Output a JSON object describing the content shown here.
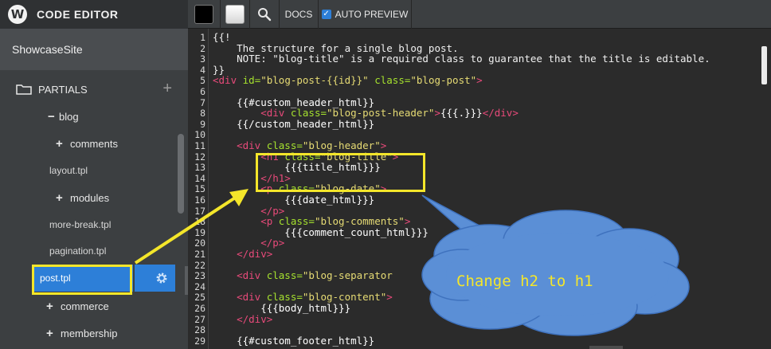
{
  "app": {
    "title": "CODE EDITOR",
    "logo_letter": "W"
  },
  "site": {
    "name": "ShowcaseSite"
  },
  "sidebar": {
    "section_label": "PARTIALS",
    "add_symbol": "+",
    "tree": [
      {
        "sign": "−",
        "label": "blog"
      },
      {
        "sign": "+",
        "label": "comments"
      },
      {
        "sign": "",
        "label": "layout.tpl"
      },
      {
        "sign": "+",
        "label": "modules"
      },
      {
        "sign": "",
        "label": "more-break.tpl"
      },
      {
        "sign": "",
        "label": "pagination.tpl"
      },
      {
        "sign": "",
        "label": "post.tpl"
      },
      {
        "sign": "+",
        "label": "commerce"
      },
      {
        "sign": "+",
        "label": "membership"
      }
    ]
  },
  "toolbar": {
    "swatch_dark_color": "#000000",
    "swatch_light_color": "#ffffff",
    "docs_label": "DOCS",
    "auto_preview_label": "AUTO PREVIEW",
    "auto_preview_checked": true,
    "check_mark": "✓"
  },
  "editor": {
    "lines": [
      {
        "n": "1",
        "segs": [
          [
            "cm",
            "{{!"
          ]
        ]
      },
      {
        "n": "2",
        "segs": [
          [
            "cm",
            "    The structure for a single blog post."
          ]
        ]
      },
      {
        "n": "3",
        "segs": [
          [
            "cm",
            "    NOTE: \"blog-title\" is a required class to guarantee that the title is editable."
          ]
        ]
      },
      {
        "n": "4",
        "segs": [
          [
            "cm",
            "}}"
          ]
        ]
      },
      {
        "n": "5",
        "segs": [
          [
            "t",
            "<div "
          ],
          [
            "a",
            "id="
          ],
          [
            "s",
            "\"blog-post-{{id}}\""
          ],
          [
            "a",
            " class="
          ],
          [
            "s",
            "\"blog-post\""
          ],
          [
            "t",
            ">"
          ]
        ]
      },
      {
        "n": "6",
        "segs": []
      },
      {
        "n": "7",
        "segs": [
          [
            "hb",
            "    {{#custom_header_html}}"
          ]
        ]
      },
      {
        "n": "8",
        "segs": [
          [
            "t",
            "        <div "
          ],
          [
            "a",
            "class="
          ],
          [
            "s",
            "\"blog-post-header\""
          ],
          [
            "t",
            ">"
          ],
          [
            "hb",
            "{{{.}}}"
          ],
          [
            "t",
            "</div>"
          ]
        ]
      },
      {
        "n": "9",
        "segs": [
          [
            "hb",
            "    {{/custom_header_html}}"
          ]
        ]
      },
      {
        "n": "10",
        "segs": []
      },
      {
        "n": "11",
        "segs": [
          [
            "t",
            "    <div "
          ],
          [
            "a",
            "class="
          ],
          [
            "s",
            "\"blog-header\""
          ],
          [
            "t",
            ">"
          ]
        ]
      },
      {
        "n": "12",
        "segs": [
          [
            "t",
            "        <h1 "
          ],
          [
            "a",
            "class="
          ],
          [
            "s",
            "\"blog-title\""
          ],
          [
            "t",
            ">"
          ]
        ]
      },
      {
        "n": "13",
        "segs": [
          [
            "hb",
            "            {{{title_html}}}"
          ]
        ]
      },
      {
        "n": "14",
        "segs": [
          [
            "t",
            "        </h1>"
          ]
        ]
      },
      {
        "n": "15",
        "segs": [
          [
            "t",
            "        <p "
          ],
          [
            "a",
            "class="
          ],
          [
            "s",
            "\"blog-date\""
          ],
          [
            "t",
            ">"
          ]
        ]
      },
      {
        "n": "16",
        "segs": [
          [
            "hb",
            "            {{{date_html}}}"
          ]
        ]
      },
      {
        "n": "17",
        "segs": [
          [
            "t",
            "        </p>"
          ]
        ]
      },
      {
        "n": "18",
        "segs": [
          [
            "t",
            "        <p "
          ],
          [
            "a",
            "class="
          ],
          [
            "s",
            "\"blog-comments\""
          ],
          [
            "t",
            ">"
          ]
        ]
      },
      {
        "n": "19",
        "segs": [
          [
            "hb",
            "            {{{comment_count_html}}}"
          ]
        ]
      },
      {
        "n": "20",
        "segs": [
          [
            "t",
            "        </p>"
          ]
        ]
      },
      {
        "n": "21",
        "segs": [
          [
            "t",
            "    </div>"
          ]
        ]
      },
      {
        "n": "22",
        "segs": []
      },
      {
        "n": "23",
        "segs": [
          [
            "t",
            "    <div "
          ],
          [
            "a",
            "class="
          ],
          [
            "s",
            "\"blog-separator"
          ]
        ]
      },
      {
        "n": "24",
        "segs": []
      },
      {
        "n": "25",
        "segs": [
          [
            "t",
            "    <div "
          ],
          [
            "a",
            "class="
          ],
          [
            "s",
            "\"blog-content\""
          ],
          [
            "t",
            ">"
          ]
        ]
      },
      {
        "n": "26",
        "segs": [
          [
            "hb",
            "        {{{body_html}}}"
          ]
        ]
      },
      {
        "n": "27",
        "segs": [
          [
            "t",
            "    </div>"
          ]
        ]
      },
      {
        "n": "28",
        "segs": []
      },
      {
        "n": "29",
        "segs": [
          [
            "hb",
            "    {{#custom_footer_html}}"
          ]
        ]
      }
    ]
  },
  "annotation": {
    "callout_text": "Change h2 to h1",
    "highlight_color": "#f4e62a",
    "cloud_color": "#5b8fd6"
  }
}
